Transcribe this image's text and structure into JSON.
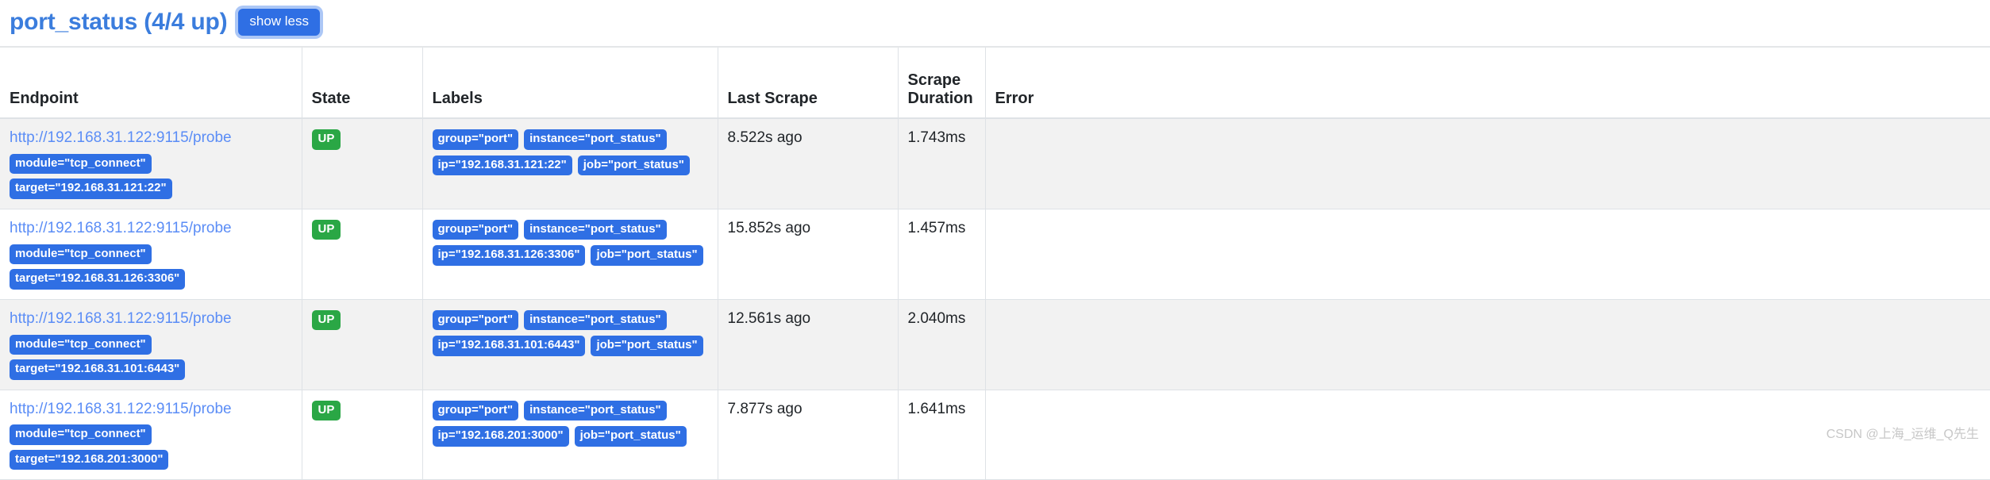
{
  "header": {
    "job_title": "port_status (4/4 up)",
    "show_less_label": "show less",
    "title_color": "#3b7ddd",
    "button_color": "#2f6fe4"
  },
  "table": {
    "columns": [
      {
        "key": "endpoint",
        "label": "Endpoint"
      },
      {
        "key": "state",
        "label": "State"
      },
      {
        "key": "labels",
        "label": "Labels"
      },
      {
        "key": "last_scrape",
        "label": "Last Scrape"
      },
      {
        "key": "scrape_duration",
        "label": "Scrape Duration"
      },
      {
        "key": "error",
        "label": "Error"
      }
    ],
    "rows": [
      {
        "endpoint_url": "http://192.168.31.122:9115/probe",
        "endpoint_badges": [
          "module=\"tcp_connect\"",
          "target=\"192.168.31.121:22\""
        ],
        "state": "UP",
        "state_color": "#2aa745",
        "labels_line1": [
          "group=\"port\"",
          "instance=\"port_status\""
        ],
        "labels_line2": [
          "ip=\"192.168.31.121:22\"",
          "job=\"port_status\""
        ],
        "last_scrape": "8.522s ago",
        "scrape_duration": "1.743ms",
        "error": ""
      },
      {
        "endpoint_url": "http://192.168.31.122:9115/probe",
        "endpoint_badges": [
          "module=\"tcp_connect\"",
          "target=\"192.168.31.126:3306\""
        ],
        "state": "UP",
        "state_color": "#2aa745",
        "labels_line1": [
          "group=\"port\"",
          "instance=\"port_status\""
        ],
        "labels_line2": [
          "ip=\"192.168.31.126:3306\"",
          "job=\"port_status\""
        ],
        "last_scrape": "15.852s ago",
        "scrape_duration": "1.457ms",
        "error": ""
      },
      {
        "endpoint_url": "http://192.168.31.122:9115/probe",
        "endpoint_badges": [
          "module=\"tcp_connect\"",
          "target=\"192.168.31.101:6443\""
        ],
        "state": "UP",
        "state_color": "#2aa745",
        "labels_line1": [
          "group=\"port\"",
          "instance=\"port_status\""
        ],
        "labels_line2": [
          "ip=\"192.168.31.101:6443\"",
          "job=\"port_status\""
        ],
        "last_scrape": "12.561s ago",
        "scrape_duration": "2.040ms",
        "error": ""
      },
      {
        "endpoint_url": "http://192.168.31.122:9115/probe",
        "endpoint_badges": [
          "module=\"tcp_connect\"",
          "target=\"192.168.201:3000\""
        ],
        "state": "UP",
        "state_color": "#2aa745",
        "labels_line1": [
          "group=\"port\"",
          "instance=\"port_status\""
        ],
        "labels_line2": [
          "ip=\"192.168.201:3000\"",
          "job=\"port_status\""
        ],
        "last_scrape": "7.877s ago",
        "scrape_duration": "1.641ms",
        "error": ""
      }
    ]
  },
  "watermark": "CSDN @上海_运维_Q先生"
}
